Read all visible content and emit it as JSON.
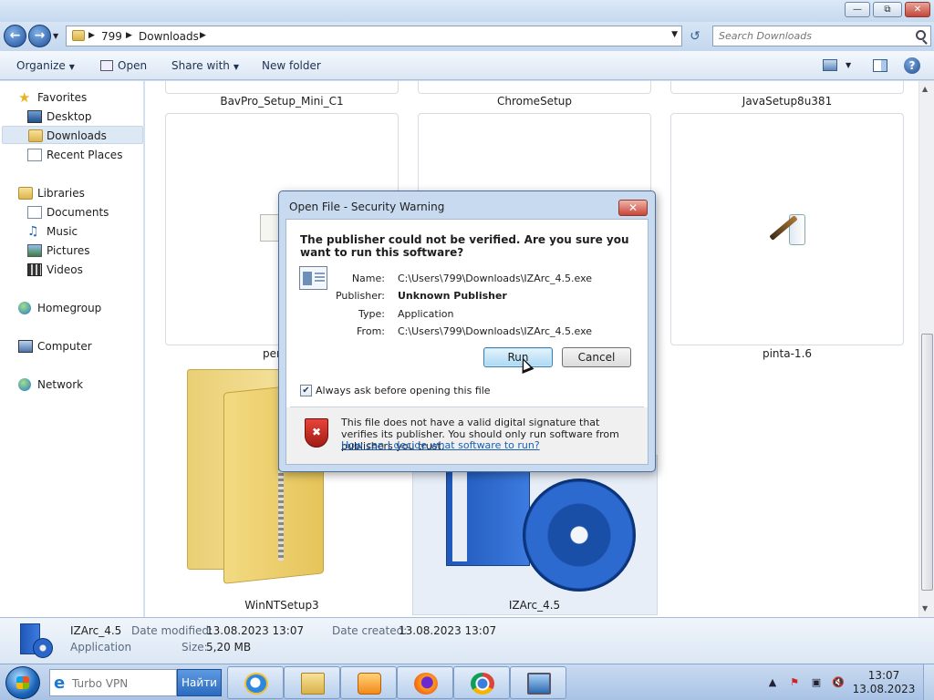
{
  "window": {
    "buttons": {
      "minimize": "—",
      "restore": "⧉",
      "close": "✕"
    }
  },
  "address": {
    "crumbs": [
      "799",
      "Downloads"
    ],
    "search_placeholder": "Search Downloads"
  },
  "toolbar": {
    "organize": "Organize",
    "open": "Open",
    "share_with": "Share with",
    "new_folder": "New folder"
  },
  "nav": {
    "favorites": "Favorites",
    "desktop": "Desktop",
    "downloads": "Downloads",
    "recent_places": "Recent Places",
    "libraries": "Libraries",
    "documents": "Documents",
    "music": "Music",
    "pictures": "Pictures",
    "videos": "Videos",
    "homegroup": "Homegroup",
    "computer": "Computer",
    "network": "Network"
  },
  "files": {
    "row1": [
      "BavPro_Setup_Mini_C1",
      "ChromeSetup",
      "JavaSetup8u381"
    ],
    "row2": [
      "per",
      "pinta-1.6"
    ],
    "row3": [
      "WinNTSetup3",
      "IZArc_4.5"
    ]
  },
  "details": {
    "name": "IZArc_4.5",
    "type": "Application",
    "date_modified_label": "Date modified:",
    "date_modified": "13.08.2023 13:07",
    "date_created_label": "Date created:",
    "date_created": "13.08.2023 13:07",
    "size_label": "Size:",
    "size": "5,20 MB"
  },
  "dialog": {
    "title": "Open File - Security Warning",
    "question": "The publisher could not be verified.  Are you sure you want to run this software?",
    "name_label": "Name:",
    "name_value": "C:\\Users\\799\\Downloads\\IZArc_4.5.exe",
    "publisher_label": "Publisher:",
    "publisher_value": "Unknown Publisher",
    "type_label": "Type:",
    "type_value": "Application",
    "from_label": "From:",
    "from_value": "C:\\Users\\799\\Downloads\\IZArc_4.5.exe",
    "run": "Run",
    "cancel": "Cancel",
    "always_ask": "Always ask before opening this file",
    "always_ask_checked": true,
    "warning": "This file does not have a valid digital signature that verifies its publisher.  You should only run software from publishers you trust.",
    "help_link": "How can I decide what software to run?"
  },
  "taskbar": {
    "search_placeholder": "Turbo VPN",
    "search_button": "Найти",
    "time": "13:07",
    "date": "13.08.2023"
  }
}
